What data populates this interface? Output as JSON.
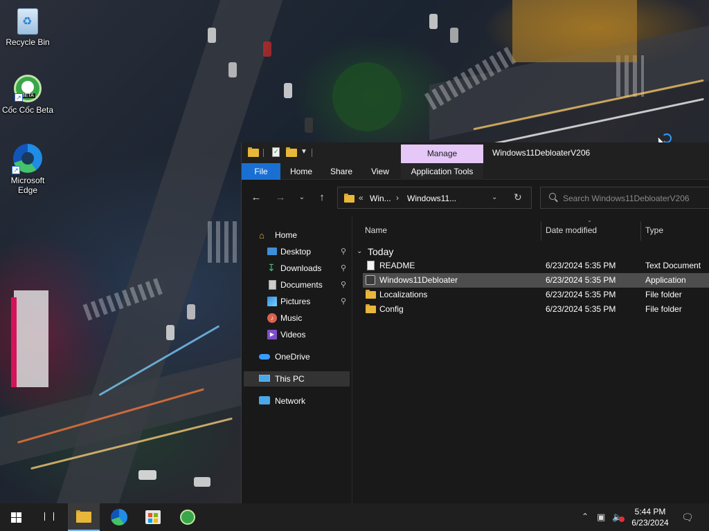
{
  "desktop": {
    "icons": [
      {
        "label": "Recycle Bin",
        "icon": "recycle-bin-icon"
      },
      {
        "label": "Cốc Cốc Beta",
        "icon": "coccoc-beta-icon",
        "badge": "BETA"
      },
      {
        "label": "Microsoft Edge",
        "icon": "edge-icon"
      }
    ]
  },
  "window": {
    "title": "Windows11DebloaterV206",
    "contextual_tab": "Manage",
    "ribbon_tabs": [
      "File",
      "Home",
      "Share",
      "View",
      "Application Tools"
    ],
    "address": {
      "overflow": "«",
      "crumbs": [
        "Win...",
        "Windows11..."
      ]
    },
    "search_placeholder": "Search Windows11DebloaterV206",
    "nav": {
      "home": "Home",
      "quick_access": [
        "Desktop",
        "Downloads",
        "Documents",
        "Pictures",
        "Music",
        "Videos"
      ],
      "onedrive": "OneDrive",
      "this_pc": "This PC",
      "network": "Network"
    },
    "columns": {
      "name": "Name",
      "date": "Date modified",
      "type": "Type"
    },
    "group": "Today",
    "files": [
      {
        "name": "README",
        "date": "6/23/2024 5:35 PM",
        "type": "Text Document",
        "kind": "doc"
      },
      {
        "name": "Windows11Debloater",
        "date": "6/23/2024 5:35 PM",
        "type": "Application",
        "kind": "app"
      },
      {
        "name": "Localizations",
        "date": "6/23/2024 5:35 PM",
        "type": "File folder",
        "kind": "folder"
      },
      {
        "name": "Config",
        "date": "6/23/2024 5:35 PM",
        "type": "File folder",
        "kind": "folder"
      }
    ]
  },
  "taskbar": {
    "clock_time": "5:44 PM",
    "clock_date": "6/23/2024"
  },
  "colors": {
    "accent": "#1a6fd2",
    "manage_tab": "#e5c8f7",
    "folder": "#e8b73a"
  }
}
